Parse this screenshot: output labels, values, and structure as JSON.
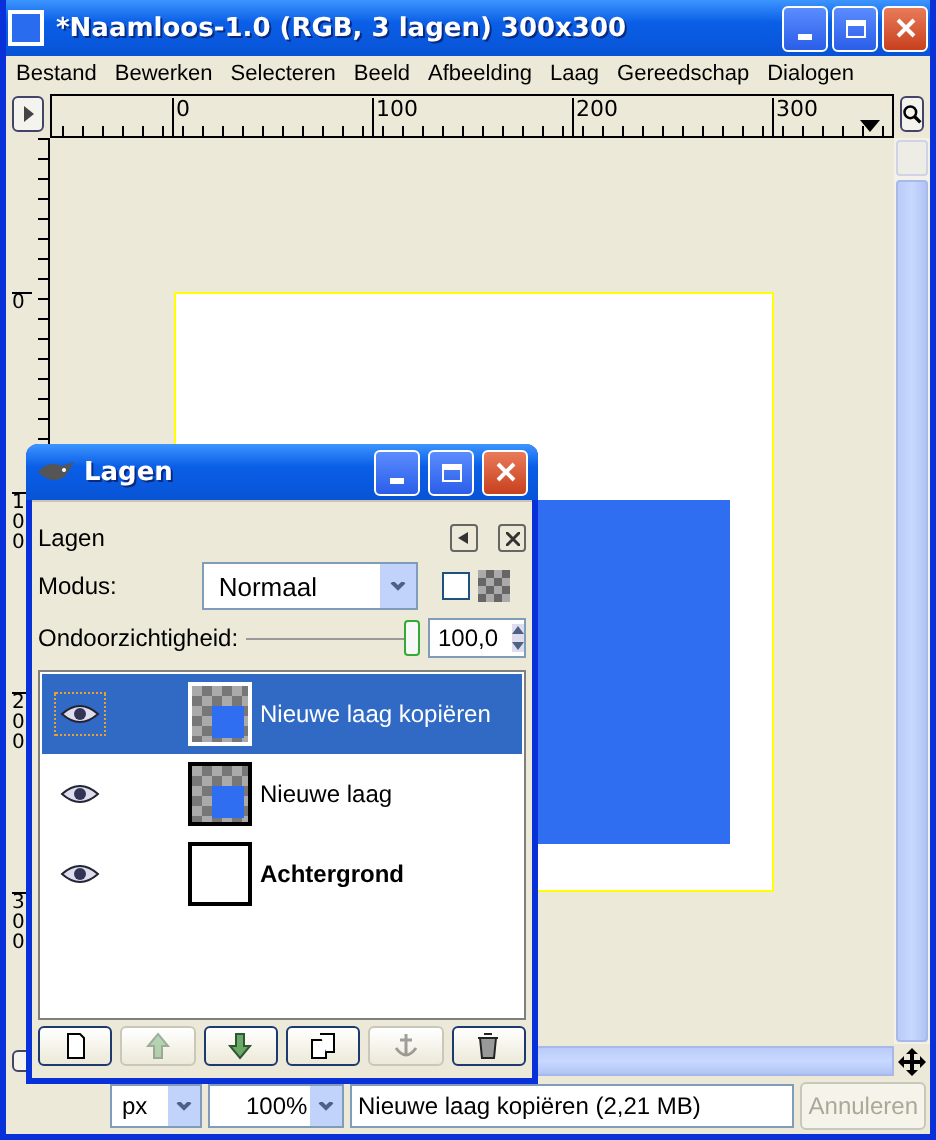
{
  "window": {
    "title": "*Naamloos-1.0 (RGB, 3 lagen) 300x300"
  },
  "menu": [
    "Bestand",
    "Bewerken",
    "Selecteren",
    "Beeld",
    "Afbeelding",
    "Laag",
    "Gereedschap",
    "Dialogen"
  ],
  "rulers": {
    "horizontal_labels": [
      "0",
      "100",
      "200",
      "300"
    ],
    "vertical_labels": [
      "0",
      "100",
      "200",
      "300"
    ]
  },
  "layers_dialog": {
    "title": "Lagen",
    "panel_title": "Lagen",
    "mode_label": "Modus:",
    "mode_value": "Normaal",
    "lock_alpha": {
      "checked": false
    },
    "opacity_label": "Ondoorzichtigheid:",
    "opacity_value": "100,0",
    "opacity": {
      "level": 1.0
    },
    "layers": [
      {
        "name": "Nieuwe laag kopiëren",
        "kind": "transparent",
        "visible": true,
        "selected": true
      },
      {
        "name": "Nieuwe laag",
        "kind": "transparent",
        "visible": true,
        "selected": false
      },
      {
        "name": "Achtergrond",
        "kind": "background",
        "visible": true,
        "selected": false
      }
    ],
    "buttons": [
      {
        "kind": "new",
        "disabled": false
      },
      {
        "kind": "raise",
        "disabled": true
      },
      {
        "kind": "lower",
        "disabled": false
      },
      {
        "kind": "duplicate",
        "disabled": false
      },
      {
        "kind": "anchor",
        "disabled": true
      },
      {
        "kind": "delete",
        "disabled": false
      }
    ]
  },
  "status_bar": {
    "unit": "px",
    "zoom": "100%",
    "message": "Nieuwe laag kopiëren (2,21 MB)",
    "cancel": {
      "label": "Annuleren",
      "disabled": true
    }
  }
}
